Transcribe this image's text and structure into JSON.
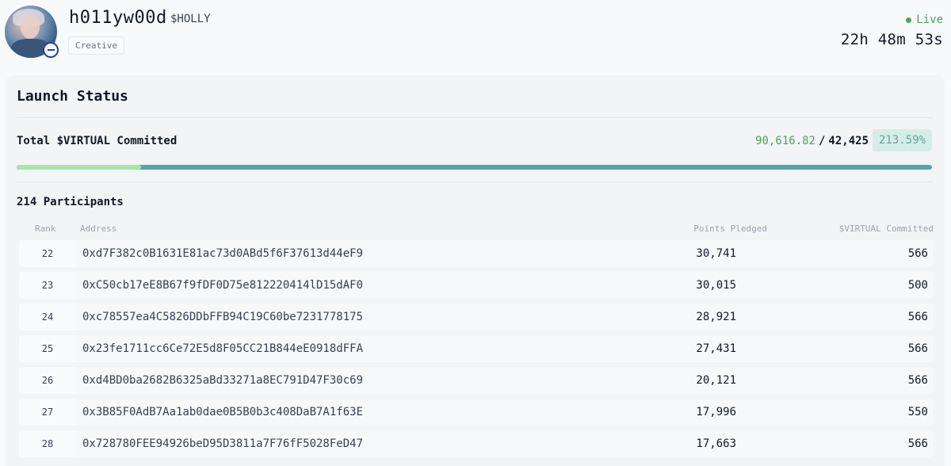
{
  "token": {
    "name": "h011yw00d",
    "ticker": "$HOLLY",
    "tag": "Creative"
  },
  "status": {
    "live_label": "Live",
    "countdown": "22h 48m 53s"
  },
  "launch": {
    "title": "Launch Status",
    "total_label": "Total $VIRTUAL Committed",
    "committed": "90,616.82",
    "separator": "/",
    "target": "42,425",
    "percent": "213.59%",
    "progress_fraction": 0.1359
  },
  "participants": {
    "count_label": "214 Participants",
    "headers": {
      "rank": "Rank",
      "address": "Address",
      "points": "Points Pledged",
      "virtual": "$VIRTUAL Committed"
    },
    "rows": [
      {
        "rank": "22",
        "address": "0xd7F382c0B1631E81ac73d0ABd5f6F37613d44eF9",
        "points": "30,741",
        "virtual": "566"
      },
      {
        "rank": "23",
        "address": "0xC50cb17eE8B67f9fDF0D75e812220414lD15dAF0",
        "points": "30,015",
        "virtual": "500"
      },
      {
        "rank": "24",
        "address": "0xc78557ea4C5826DDbFFB94C19C60be7231778175",
        "points": "28,921",
        "virtual": "566"
      },
      {
        "rank": "25",
        "address": "0x23fe1711cc6Ce72E5d8F05CC21B844eE0918dFFA",
        "points": "27,431",
        "virtual": "566"
      },
      {
        "rank": "26",
        "address": "0xd4BD0ba2682B6325aBd33271a8EC791D47F30c69",
        "points": "20,121",
        "virtual": "566"
      },
      {
        "rank": "27",
        "address": "0x3B85F0AdB7Aa1ab0dae0B5B0b3c408DaB7A1f63E",
        "points": "17,996",
        "virtual": "550"
      },
      {
        "rank": "28",
        "address": "0x728780FEE94926beD95D3811a7F76fF5028FeD47",
        "points": "17,663",
        "virtual": "566"
      }
    ]
  },
  "colors": {
    "accent_green": "#4ba35b",
    "progress_fill": "#a5e8a8",
    "progress_track": "#5ba2a8",
    "percent_badge_bg": "#d6ece9",
    "percent_badge_text": "#5ba9a0"
  }
}
